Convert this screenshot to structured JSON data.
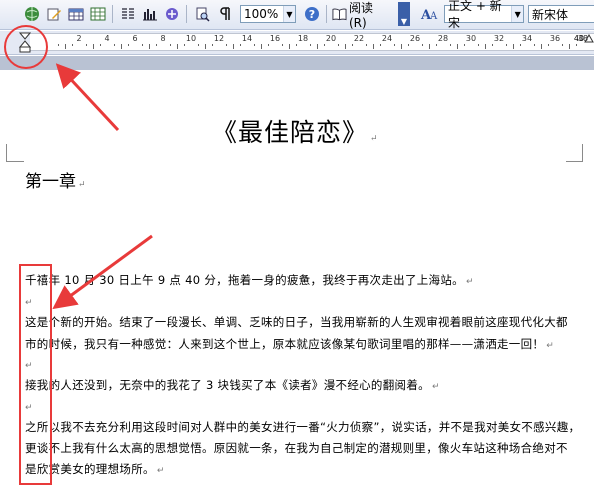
{
  "toolbar": {
    "zoom": "100%",
    "read_label": "阅读(R)",
    "style_value": "正文 + 新宋",
    "font_value": "新宋体"
  },
  "ruler": {
    "numbers": [
      "2",
      "4",
      "6",
      "8",
      "10",
      "12",
      "14",
      "16",
      "18",
      "20",
      "22",
      "24",
      "26",
      "28",
      "30",
      "32",
      "34",
      "36",
      "38"
    ],
    "end_label": "40"
  },
  "document": {
    "title": "《最佳陪恋》",
    "chapter": "第一章",
    "lines": [
      "千禧年 10 月 30 日上午 9 点 40 分，拖着一身的疲惫，我终于再次走出了上海站。",
      "",
      "这是个新的开始。结束了一段漫长、单调、乏味的日子，当我用崭新的人生观审视着眼前这座现代化大都",
      "市的时候，我只有一种感觉：人来到这个世上，原本就应该像某句歌词里唱的那样——潇洒走一回！",
      "",
      "接我的人还没到，无奈中的我花了 3 块钱买了本《读者》漫不经心的翻阅着。",
      "",
      "之所以我不去充分利用这段时间对人群中的美女进行一番“火力侦察”，说实话，并不是我对美女不感兴趣，",
      "更谈不上我有什么太高的思想觉悟。原因就一条，在我为自己制定的潜规则里，像火车站这种场合绝对不",
      "是欣赏美女的理想场所。"
    ],
    "paragraph_mark": "↵"
  },
  "colors": {
    "annotation_red": "#e83a3a"
  }
}
